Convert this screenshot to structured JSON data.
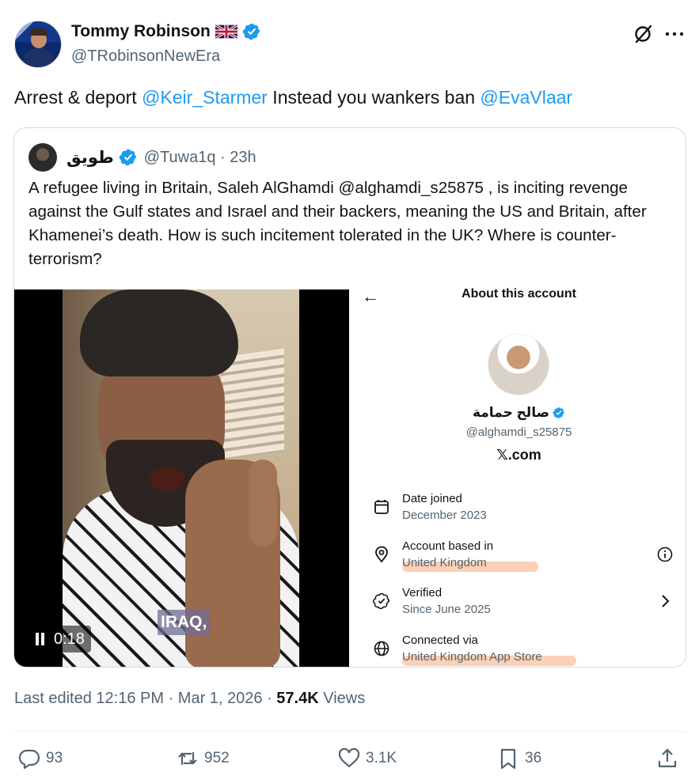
{
  "author": {
    "name": "Tommy Robinson",
    "flag_emoji": "🇬🇧",
    "handle": "@TRobinsonNewEra",
    "verified": true
  },
  "tweet": {
    "text_prefix": "Arrest & deport ",
    "mention1": "@Keir_Starmer",
    "text_middle": " Instead you wankers ban ",
    "mention2": "@EvaVlaar"
  },
  "quote": {
    "name": "طويق",
    "handle_time": "@Tuwa1q · 23h",
    "text": "A refugee living in Britain, Saleh AlGhamdi @alghamdi_s25875 , is inciting revenge against the Gulf states and Israel and their backers, meaning the US and Britain, after Khamenei’s death. How is such incitement tolerated in the UK? Where is counter-terrorism?",
    "video": {
      "caption": "IRAQ,",
      "time": "0:18"
    },
    "about": {
      "back_label": "←",
      "title": "About this account",
      "account_name": "صالح حمامة",
      "account_handle": "@alghamdi_s25875",
      "site": "𝕏.com",
      "rows": [
        {
          "label": "Date joined",
          "value": "December 2023",
          "icon": "calendar-icon"
        },
        {
          "label": "Account based in",
          "value": "United Kingdom",
          "icon": "location-pin-icon"
        },
        {
          "label": "Verified",
          "value": "Since June 2025",
          "icon": "verified-badge-icon"
        },
        {
          "label": "Connected via",
          "value": "United Kingdom App Store",
          "icon": "globe-icon"
        }
      ]
    }
  },
  "meta": {
    "edited": "Last edited 12:16 PM · Mar 1, 2026 · ",
    "views_count": "57.4K",
    "views_label": " Views"
  },
  "actions": {
    "replies": "93",
    "reposts": "952",
    "likes": "3.1K",
    "bookmarks": "36"
  },
  "colors": {
    "accent": "#1d9bf0",
    "secondary_text": "#536471",
    "highlight": "#f8aa78"
  }
}
